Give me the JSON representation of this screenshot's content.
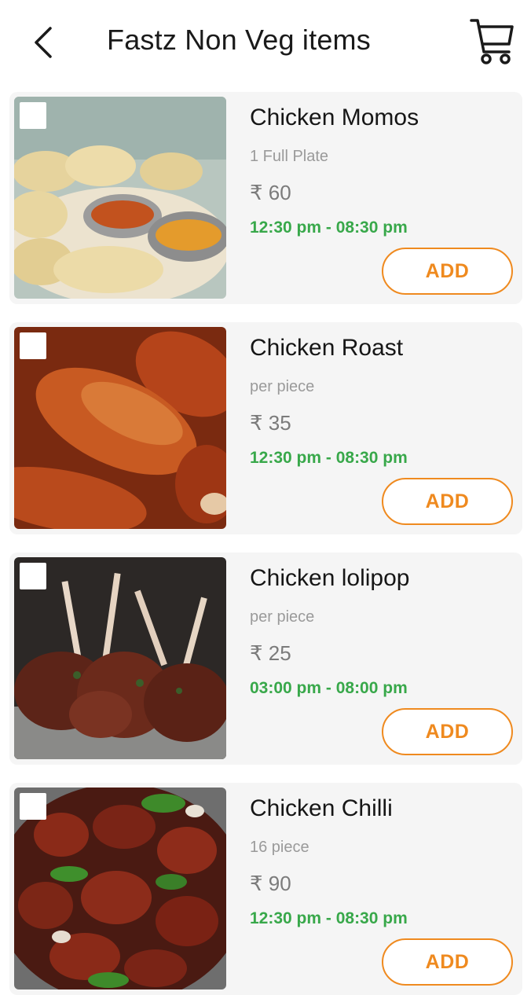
{
  "header": {
    "title": "Fastz Non Veg items",
    "back_icon": "chevron-left-icon",
    "cart_icon": "cart-icon"
  },
  "theme": {
    "accent": "#ef8a1f",
    "timing_color": "#38a84a",
    "card_bg": "#f5f5f5"
  },
  "items": [
    {
      "name": "Chicken Momos",
      "unit": "1 Full Plate",
      "price": "₹ 60",
      "timing": "12:30 pm - 08:30 pm",
      "add_label": "ADD"
    },
    {
      "name": "Chicken Roast",
      "unit": "per piece",
      "price": "₹ 35",
      "timing": "12:30 pm - 08:30 pm",
      "add_label": "ADD"
    },
    {
      "name": "Chicken lolipop",
      "unit": "per piece",
      "price": "₹ 25",
      "timing": "03:00 pm - 08:00 pm",
      "add_label": "ADD"
    },
    {
      "name": "Chicken Chilli",
      "unit": "16 piece",
      "price": "₹ 90",
      "timing": "12:30 pm - 08:30 pm",
      "add_label": "ADD"
    }
  ]
}
